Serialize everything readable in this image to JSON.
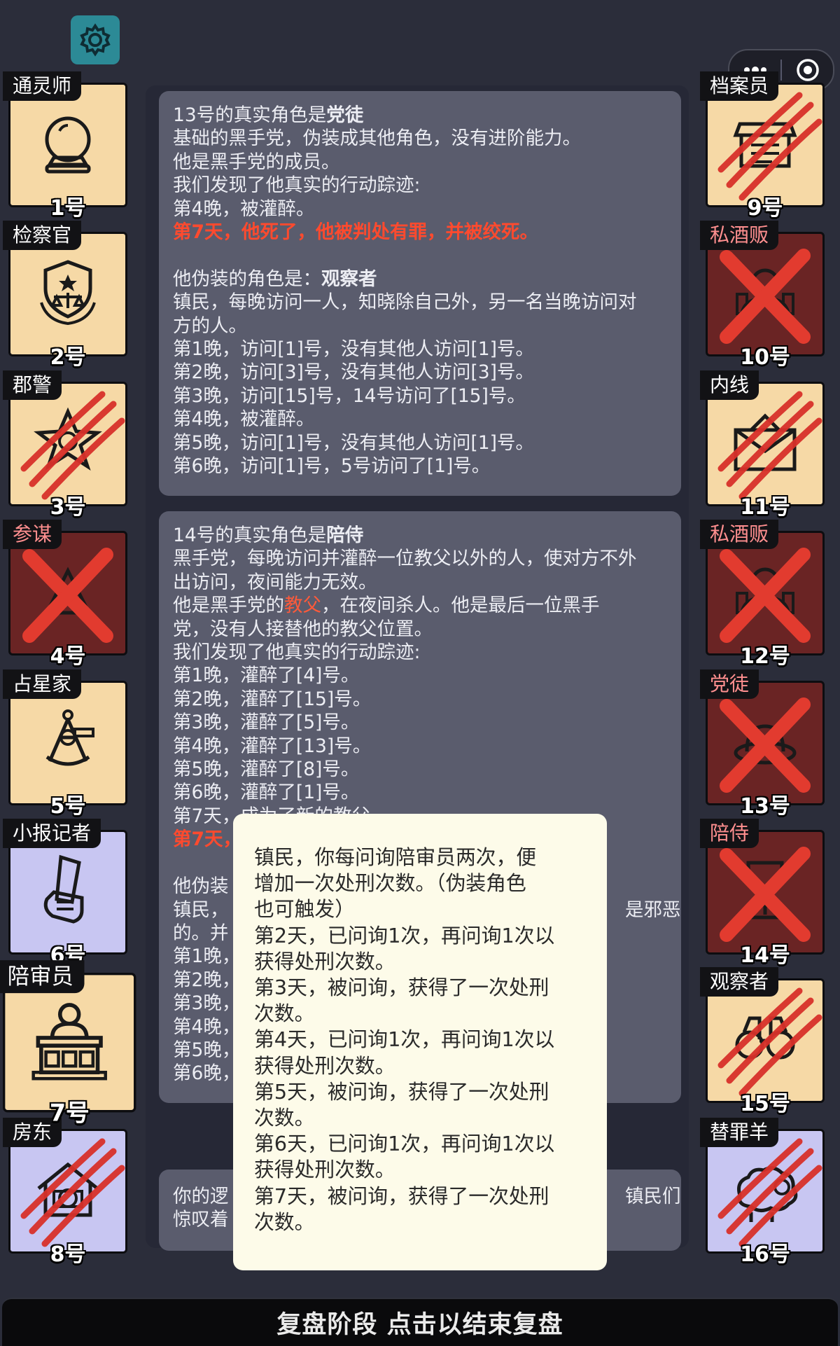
{
  "settings_icon": "gear-icon",
  "capsule": {
    "more_icon": "more-dots-icon",
    "close_icon": "target-circle-icon"
  },
  "players_left": [
    {
      "role": "通灵师",
      "number": "1号",
      "status": "alive",
      "icon": "crystal-ball-icon"
    },
    {
      "role": "检察官",
      "number": "2号",
      "status": "alive",
      "icon": "police-badge-icon"
    },
    {
      "role": "郡警",
      "number": "3号",
      "status": "killed",
      "icon": "sheriff-star-icon"
    },
    {
      "role": "参谋",
      "number": "4号",
      "status": "executed",
      "icon": "strategist-icon",
      "evil": true
    },
    {
      "role": "占星家",
      "number": "5号",
      "status": "alive",
      "icon": "sextant-icon"
    },
    {
      "role": "小报记者",
      "number": "6号",
      "status": "alive",
      "icon": "newspaper-fist-icon"
    },
    {
      "role": "陪审员",
      "number": "7号",
      "status": "alive",
      "icon": "juror-podium-icon",
      "highlighted": true
    },
    {
      "role": "房东",
      "number": "8号",
      "status": "killed",
      "icon": "house-icon"
    }
  ],
  "players_right": [
    {
      "role": "档案员",
      "number": "9号",
      "status": "killed",
      "icon": "archive-box-icon"
    },
    {
      "role": "私酒贩",
      "number": "10号",
      "status": "executed",
      "icon": "bootlegger-icon",
      "evil": true
    },
    {
      "role": "内线",
      "number": "11号",
      "status": "killed",
      "icon": "envelope-icon"
    },
    {
      "role": "私酒贩",
      "number": "12号",
      "status": "executed",
      "icon": "bootlegger-icon",
      "evil": true
    },
    {
      "role": "党徒",
      "number": "13号",
      "status": "executed",
      "icon": "fedora-hat-icon",
      "evil": true
    },
    {
      "role": "陪侍",
      "number": "14号",
      "status": "executed",
      "icon": "wine-glass-icon",
      "evil": true
    },
    {
      "role": "观察者",
      "number": "15号",
      "status": "killed",
      "icon": "binoculars-icon"
    },
    {
      "role": "替罪羊",
      "number": "16号",
      "status": "killed",
      "icon": "sheep-icon"
    }
  ],
  "card1": {
    "title_prefix": "13号的真实角色是",
    "title_role": "党徒",
    "lines": [
      "基础的黑手党，伪装成其他角色，没有进阶能力。",
      "他是黑手党的成员。",
      "我们发现了他真实的行动踪迹:",
      "第4晚，被灌醉。"
    ],
    "death_line": "第7天，他死了，他被判处有罪，并被绞死。",
    "disguise_prefix": "他伪装的角色是：",
    "disguise_role": "观察者",
    "disguise_lines": [
      "镇民，每晚访问一人，知晓除自己外，另一名当晚访问对",
      "方的人。",
      "第1晚，访问[1]号，没有其他人访问[1]号。",
      "第2晚，访问[3]号，没有其他人访问[3]号。",
      "第3晚，访问[15]号，14号访问了[15]号。",
      "第4晚，被灌醉。",
      "第5晚，访问[1]号，没有其他人访问[1]号。",
      "第6晚，访问[1]号，5号访问了[1]号。"
    ]
  },
  "card2": {
    "title_prefix": "14号的真实角色是",
    "title_role": "陪侍",
    "line1": "黑手党，每晚访问并灌醉一位教父以外的人，使对方不外",
    "line2": "出访问，夜间能力无效。",
    "line3_a": "他是黑手党的",
    "line3_b": "教父",
    "line3_c": "，在夜间杀人。他是最后一位黑手",
    "line4": "党，没有人接替他的教父位置。",
    "line5": "我们发现了他真实的行动踪迹:",
    "night_lines": [
      "第1晚，灌醉了[4]号。",
      "第2晚，灌醉了[15]号。",
      "第3晚，灌醉了[5]号。",
      "第4晚，灌醉了[13]号。",
      "第5晚，灌醉了[8]号。",
      "第6晚，灌醉了[1]号。",
      "第7天，成为了新的教父。"
    ],
    "death_partial": "第7天，",
    "disguise_partial": "他伪装",
    "disguise_desc_a": "镇民，",
    "disguise_desc_right": "是邪恶",
    "disguise_desc_b": "的。并",
    "partial_nights": [
      "第1晚，",
      "第2晚，",
      "第3晚，",
      "第4晚，",
      "第5晚，",
      "第6晚，"
    ]
  },
  "card3": {
    "left_a": "你的逻",
    "left_b": "惊叹着",
    "right_a": "镇民们"
  },
  "tooltip": {
    "lines": [
      "镇民，你每问询陪审员两次，便",
      "增加一次处刑次数。（伪装角色",
      "也可触发）",
      "第2天，已问询1次，再问询1次以",
      "获得处刑次数。",
      "第3天，被问询，获得了一次处刑",
      "次数。",
      "第4天，已问询1次，再问询1次以",
      "获得处刑次数。",
      "第5天，被问询，获得了一次处刑",
      "次数。",
      "第6天，已问询1次，再问询1次以",
      "获得处刑次数。",
      "第7天，被问询，获得了一次处刑",
      "次数。"
    ]
  },
  "bottom_bar": {
    "label": "复盘阶段 点击以结束复盘"
  },
  "colors": {
    "background": "#2b2d3a",
    "card": "#5a5c6d",
    "alive_tile": "#f6d9a6",
    "dead_tile": "#6a2424",
    "highlight_red": "#ff4a2e"
  }
}
